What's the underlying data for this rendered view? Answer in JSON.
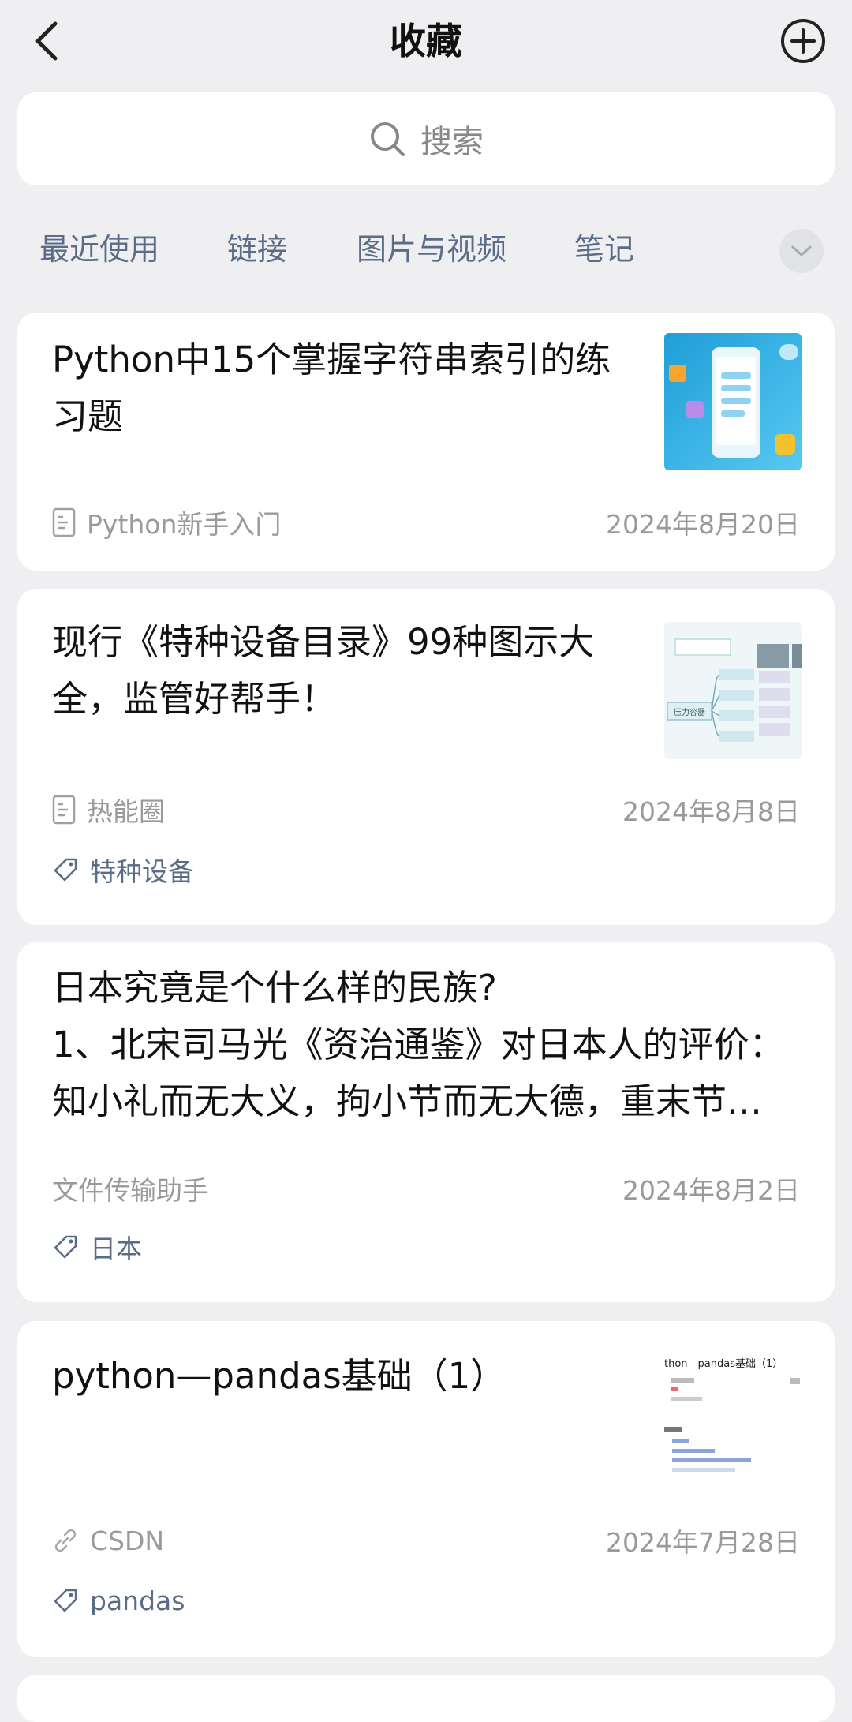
{
  "header": {
    "title": "收藏"
  },
  "search": {
    "placeholder": "搜索"
  },
  "tabs": [
    {
      "label": "最近使用"
    },
    {
      "label": "链接"
    },
    {
      "label": "图片与视频"
    },
    {
      "label": "笔记"
    }
  ],
  "items": [
    {
      "title_line1": "Python中15个掌握字符串索引的练",
      "title_line2": "习题",
      "source": "Python新手入门",
      "source_icon": "document-icon",
      "date": "2024年8月20日",
      "thumb_colors": [
        "#22a7e0",
        "#4ec5f3"
      ]
    },
    {
      "title_line1": "现行《特种设备目录》99种图示大",
      "title_line2": "全，监管好帮手！",
      "source": "热能圈",
      "source_icon": "document-icon",
      "date": "2024年8月8日",
      "tag": "特种设备",
      "thumb_text": "压力容器"
    },
    {
      "title_line1": "日本究竟是个什么样的民族?",
      "title_line2": "1、北宋司马光《资治通鉴》对日本人的评价：",
      "title_line3": "知小礼而无大义，拘小节而无大德，重末节…",
      "source": "文件传输助手",
      "date": "2024年8月2日",
      "tag": "日本"
    },
    {
      "title_line1": "python—pandas基础（1）",
      "source": "CSDN",
      "source_icon": "link-icon",
      "date": "2024年7月28日",
      "tag": "pandas",
      "thumb_text": "thon—pandas基础（1）"
    }
  ],
  "colors": {
    "accent_text": "#5a6c86",
    "background": "#efeff2"
  }
}
